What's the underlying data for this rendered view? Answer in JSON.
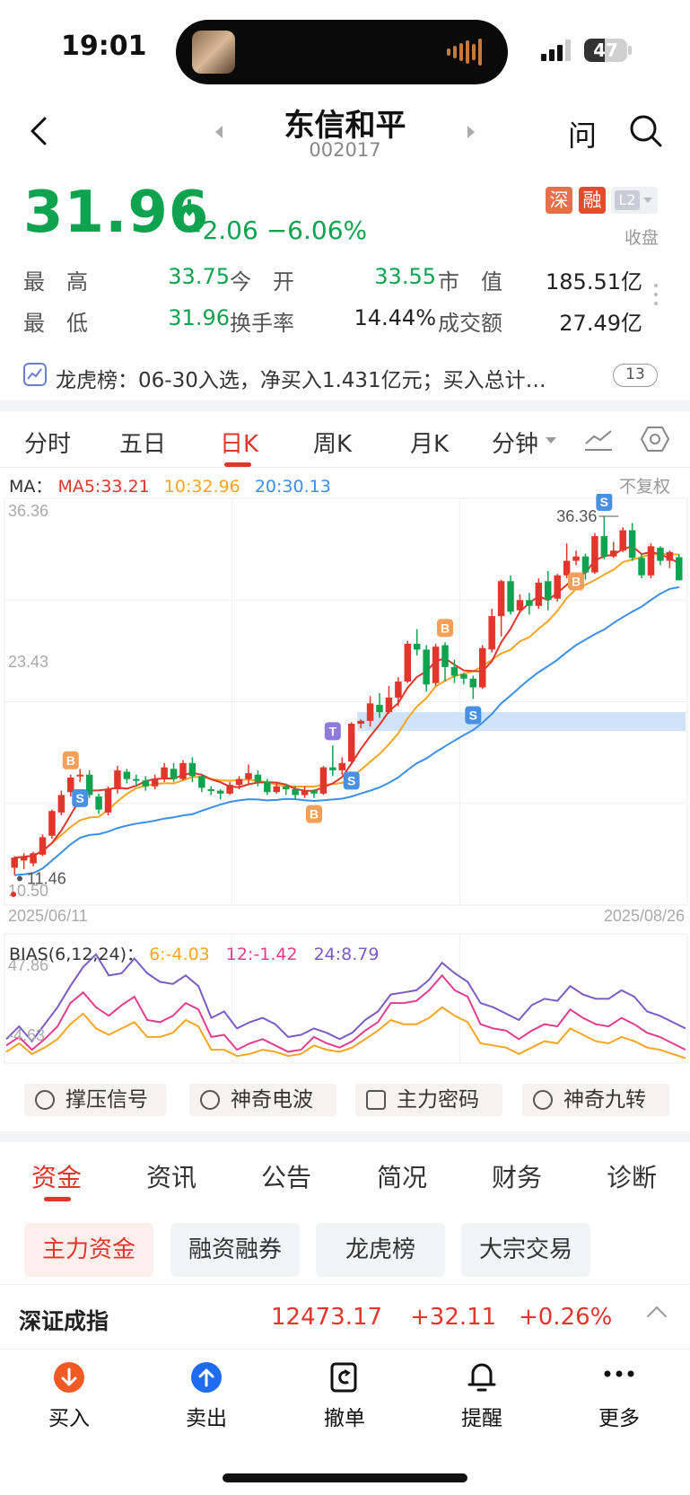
{
  "status": {
    "time": "19:01",
    "battery": "47"
  },
  "nav": {
    "title": "东信和平",
    "code": "002017",
    "ask": "问"
  },
  "quote": {
    "price": "31.96",
    "change": "−2.06  −6.06%",
    "badges": [
      "深",
      "融",
      "L2"
    ],
    "market_status": "收盘",
    "stats": [
      {
        "label": "最　高",
        "value": "33.75"
      },
      {
        "label": "今　开",
        "value": "33.55"
      },
      {
        "label": "市　值",
        "value": "185.51亿"
      },
      {
        "label": "最　低",
        "value": "31.96"
      },
      {
        "label": "换手率",
        "value": "14.44%"
      },
      {
        "label": "成交额",
        "value": "27.49亿"
      }
    ]
  },
  "dragon_tiger": {
    "text": "龙虎榜：06-30入选，净买入1.431亿元；买入总计…",
    "count": "13"
  },
  "chart_tabs": [
    "分时",
    "五日",
    "日K",
    "周K",
    "月K",
    "分钟"
  ],
  "ma_legend": {
    "prefix": "MA：",
    "ma5": "MA5:33.21",
    "ma10": "10:32.96",
    "ma20": "20:30.13",
    "adjust": "不复权"
  },
  "bias_legend": {
    "prefix": "BIAS(6,12,24)：",
    "b6": "6:-4.03",
    "b12": "12:-1.42",
    "b24": "24:8.79"
  },
  "colors": {
    "up": "#e2352b",
    "down": "#0fa34f",
    "ma5": "#e2352b",
    "ma10": "#f5a623",
    "ma20": "#3d8fe6",
    "bias24": "#7a5cc4",
    "bias12": "#e23d8f"
  },
  "chart_data": {
    "type": "candlestick",
    "x_start": "2025/06/11",
    "x_end": "2025/08/26",
    "y_labels": [
      "36.36",
      "23.43",
      "10.50"
    ],
    "high_marker": "36.36",
    "low_marker": "11.46",
    "ylim": [
      10.5,
      36.36
    ],
    "candles": [
      [
        12.2,
        12.9,
        11.7,
        13.0
      ],
      [
        12.7,
        13.0,
        12.1,
        13.2
      ],
      [
        12.5,
        13.2,
        12.3,
        13.3
      ],
      [
        13.1,
        14.3,
        13.0,
        14.5
      ],
      [
        14.4,
        16.1,
        14.2,
        16.2
      ],
      [
        16.0,
        17.2,
        15.8,
        17.5
      ],
      [
        17.4,
        18.4,
        17.1,
        18.6
      ],
      [
        18.5,
        18.6,
        18.1,
        19.0
      ],
      [
        18.6,
        17.2,
        17.0,
        18.9
      ],
      [
        17.1,
        16.2,
        15.9,
        17.3
      ],
      [
        16.0,
        17.6,
        15.8,
        17.8
      ],
      [
        17.6,
        18.9,
        17.3,
        19.2
      ],
      [
        18.8,
        18.3,
        18.0,
        19.0
      ],
      [
        18.3,
        18.2,
        17.8,
        18.6
      ],
      [
        18.2,
        17.8,
        17.5,
        18.5
      ],
      [
        17.8,
        18.3,
        17.6,
        18.6
      ],
      [
        18.3,
        19.1,
        18.1,
        19.4
      ],
      [
        19.0,
        18.3,
        18.1,
        19.4
      ],
      [
        18.3,
        19.4,
        18.2,
        19.6
      ],
      [
        19.4,
        18.5,
        18.1,
        19.8
      ],
      [
        18.5,
        17.7,
        17.4,
        18.6
      ],
      [
        17.6,
        17.5,
        17.2,
        17.8
      ],
      [
        17.5,
        17.3,
        16.9,
        17.6
      ],
      [
        17.3,
        17.9,
        17.2,
        18.1
      ],
      [
        17.9,
        18.3,
        17.6,
        18.5
      ],
      [
        18.3,
        18.7,
        18.0,
        19.3
      ],
      [
        18.6,
        18.1,
        17.8,
        18.9
      ],
      [
        18.1,
        17.4,
        17.2,
        18.3
      ],
      [
        17.4,
        17.8,
        17.3,
        18.0
      ],
      [
        17.8,
        17.6,
        17.2,
        18.0
      ],
      [
        17.6,
        17.2,
        16.9,
        17.8
      ],
      [
        17.2,
        17.5,
        17.0,
        17.8
      ],
      [
        17.5,
        17.3,
        17.0,
        17.6
      ],
      [
        17.3,
        19.1,
        17.2,
        19.2
      ],
      [
        19.1,
        18.9,
        18.5,
        20.6
      ],
      [
        18.9,
        19.4,
        18.6,
        19.8
      ],
      [
        19.5,
        22.1,
        19.3,
        22.2
      ],
      [
        22.1,
        22.3,
        21.8,
        22.4
      ],
      [
        22.3,
        23.5,
        21.9,
        24.0
      ],
      [
        23.4,
        22.9,
        22.5,
        24.2
      ],
      [
        22.9,
        23.9,
        22.8,
        24.7
      ],
      [
        23.9,
        25.0,
        23.3,
        25.3
      ],
      [
        25.0,
        27.6,
        24.9,
        27.8
      ],
      [
        27.6,
        27.2,
        26.8,
        28.6
      ],
      [
        27.2,
        24.8,
        24.3,
        27.5
      ],
      [
        24.9,
        27.4,
        24.7,
        27.6
      ],
      [
        27.5,
        26.0,
        25.0,
        27.7
      ],
      [
        26.0,
        25.4,
        24.9,
        26.5
      ],
      [
        25.5,
        25.2,
        24.8,
        25.6
      ],
      [
        25.2,
        24.6,
        23.8,
        25.4
      ],
      [
        24.6,
        27.3,
        24.5,
        27.5
      ],
      [
        27.2,
        29.5,
        27.0,
        30.0
      ],
      [
        29.5,
        31.9,
        28.1,
        32.0
      ],
      [
        31.9,
        29.8,
        29.6,
        32.3
      ],
      [
        29.9,
        30.6,
        29.7,
        31.0
      ],
      [
        30.6,
        30.2,
        29.6,
        31.1
      ],
      [
        30.2,
        31.8,
        30.0,
        32.1
      ],
      [
        31.9,
        30.6,
        29.9,
        32.6
      ],
      [
        30.7,
        32.3,
        30.5,
        32.4
      ],
      [
        32.3,
        33.3,
        32.1,
        34.5
      ],
      [
        33.3,
        33.6,
        33.0,
        34.0
      ],
      [
        33.6,
        32.5,
        32.0,
        33.8
      ],
      [
        32.5,
        35.0,
        32.4,
        35.2
      ],
      [
        35.0,
        33.6,
        33.4,
        36.36
      ],
      [
        33.6,
        34.0,
        33.5,
        34.6
      ],
      [
        34.0,
        35.4,
        33.9,
        35.6
      ],
      [
        35.4,
        33.5,
        33.3,
        35.9
      ],
      [
        33.5,
        32.3,
        32.1,
        33.8
      ],
      [
        32.3,
        34.3,
        32.1,
        34.5
      ],
      [
        34.2,
        33.3,
        33.0,
        34.3
      ],
      [
        33.3,
        33.9,
        32.8,
        34.0
      ],
      [
        33.55,
        31.96,
        31.96,
        33.75
      ]
    ],
    "bias_ylim": [
      -4.63,
      47.86
    ],
    "bias_y_labels": [
      "47.86",
      "-4.63"
    ],
    "bias24": [
      5,
      11,
      4,
      12,
      20,
      30,
      39,
      45,
      35,
      36,
      43,
      36,
      32,
      31,
      35,
      30,
      15,
      18,
      10,
      13,
      15,
      12,
      6,
      7,
      10,
      8,
      5,
      8,
      14,
      18,
      26,
      27,
      28,
      33,
      41,
      36,
      32,
      22,
      20,
      17,
      14,
      21,
      24,
      23,
      30,
      26,
      24,
      24,
      28,
      25,
      18,
      16,
      13,
      10
    ],
    "bias12": [
      2,
      6,
      0,
      5,
      11,
      22,
      27,
      20,
      16,
      21,
      25,
      14,
      13,
      16,
      22,
      19,
      6,
      7,
      0,
      3,
      5,
      2,
      -1,
      0,
      6,
      3,
      1,
      4,
      9,
      13,
      22,
      22,
      23,
      28,
      35,
      28,
      25,
      12,
      10,
      9,
      5,
      9,
      12,
      11,
      19,
      15,
      12,
      11,
      15,
      12,
      8,
      6,
      3,
      0
    ],
    "bias6": [
      -1,
      3,
      -2,
      1,
      5,
      12,
      17,
      10,
      7,
      10,
      13,
      6,
      6,
      8,
      14,
      11,
      0,
      0,
      -3,
      -2,
      0,
      -1,
      -3,
      -2,
      2,
      0,
      -1,
      1,
      5,
      9,
      14,
      12,
      12,
      15,
      20,
      16,
      13,
      3,
      2,
      1,
      -2,
      1,
      4,
      3,
      10,
      7,
      4,
      3,
      6,
      4,
      1,
      0,
      -2,
      -4
    ],
    "signals": [
      {
        "label": "B",
        "idx": 6,
        "pos": "above"
      },
      {
        "label": "S",
        "idx": 7,
        "pos": "below"
      },
      {
        "label": "T",
        "idx": 34,
        "pos": "above"
      },
      {
        "label": "S",
        "idx": 36,
        "pos": "below"
      },
      {
        "label": "B",
        "idx": 32,
        "pos": "below"
      },
      {
        "label": "B",
        "idx": 46,
        "pos": "above"
      },
      {
        "label": "S",
        "idx": 49,
        "pos": "below"
      },
      {
        "label": "B",
        "idx": 60,
        "pos": "below"
      },
      {
        "label": "S",
        "idx": 63,
        "pos": "above"
      }
    ],
    "band": [
      21.6,
      22.9
    ]
  },
  "signal_buttons": [
    "撑压信号",
    "神奇电波",
    "主力密码",
    "神奇九转"
  ],
  "section_tabs": [
    "资金",
    "资讯",
    "公告",
    "简况",
    "财务",
    "诊断"
  ],
  "pills": [
    "主力资金",
    "融资融券",
    "龙虎榜",
    "大宗交易"
  ],
  "index": {
    "name": "深证成指",
    "value": "12473.17",
    "change": "+32.11",
    "pct": "+0.26%"
  },
  "bottom_actions": [
    "买入",
    "卖出",
    "撤单",
    "提醒",
    "更多"
  ]
}
